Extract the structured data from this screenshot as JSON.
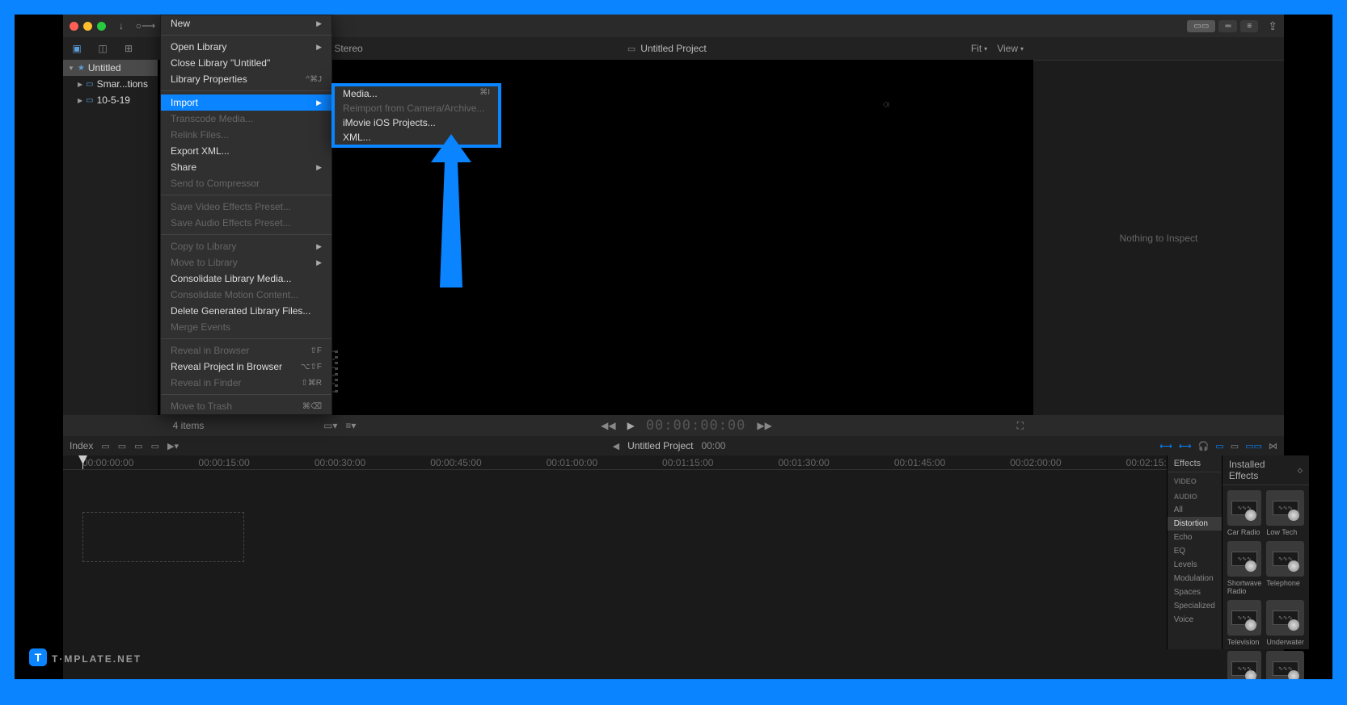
{
  "toolbar": {
    "share_tooltip": "Share"
  },
  "library": {
    "root": "Untitled",
    "items": [
      "Smar...tions",
      "10-5-19"
    ]
  },
  "contextMenu": {
    "new": "New",
    "openLibrary": "Open Library",
    "closeLibrary": "Close Library \"Untitled\"",
    "libraryProperties": "Library Properties",
    "libraryPropertiesShortcut": "^⌘J",
    "import": "Import",
    "transcode": "Transcode Media...",
    "relink": "Relink Files...",
    "exportXml": "Export XML...",
    "shareItem": "Share",
    "sendCompressor": "Send to Compressor",
    "saveVideoPreset": "Save Video Effects Preset...",
    "saveAudioPreset": "Save Audio Effects Preset...",
    "copyToLibrary": "Copy to Library",
    "moveToLibrary": "Move to Library",
    "consolidateMedia": "Consolidate Library Media...",
    "consolidateMotion": "Consolidate Motion Content...",
    "deleteGenerated": "Delete Generated Library Files...",
    "mergeEvents": "Merge Events",
    "revealBrowser": "Reveal in Browser",
    "revealBrowserShortcut": "⇧F",
    "revealProject": "Reveal Project in Browser",
    "revealProjectShortcut": "⌥⇧F",
    "revealFinder": "Reveal in Finder",
    "revealFinderShortcut": "⇧⌘R",
    "moveTrash": "Move to Trash",
    "moveTrashShortcut": "⌘⌫"
  },
  "submenu": {
    "media": "Media...",
    "mediaShortcut": "⌘I",
    "reimport": "Reimport from Camera/Archive...",
    "imovie": "iMovie iOS Projects...",
    "xml": "XML..."
  },
  "viewer": {
    "audioInfo": "p, Stereo",
    "projectTitle": "Untitled Project",
    "fit": "Fit",
    "view": "View"
  },
  "inspector": {
    "empty": "Nothing to Inspect"
  },
  "infoBar": {
    "itemCount": "4 items",
    "timecode": "00:00:00:00"
  },
  "timelineToolbar": {
    "index": "Index",
    "projectTitle": "Untitled Project",
    "projectTime": "00:00"
  },
  "timelineRuler": [
    "00:00:00:00",
    "00:00:15:00",
    "00:00:30:00",
    "00:00:45:00",
    "00:01:00:00",
    "00:01:15:00",
    "00:01:30:00",
    "00:01:45:00",
    "00:02:00:00",
    "00:02:15:"
  ],
  "effectsPanel": {
    "header": "Effects",
    "categories": {
      "video": "VIDEO",
      "audio": "AUDIO",
      "all": "All",
      "distortion": "Distortion",
      "echo": "Echo",
      "eq": "EQ",
      "levels": "Levels",
      "modulation": "Modulation",
      "spaces": "Spaces",
      "specialized": "Specialized",
      "voice": "Voice"
    }
  },
  "effectsGrid": {
    "header": "Installed Effects",
    "items": [
      "Car Radio",
      "Low Tech",
      "Shortwave Radio",
      "Telephone",
      "Television",
      "Underwater"
    ]
  },
  "watermark": "T·MPLATE.NET"
}
